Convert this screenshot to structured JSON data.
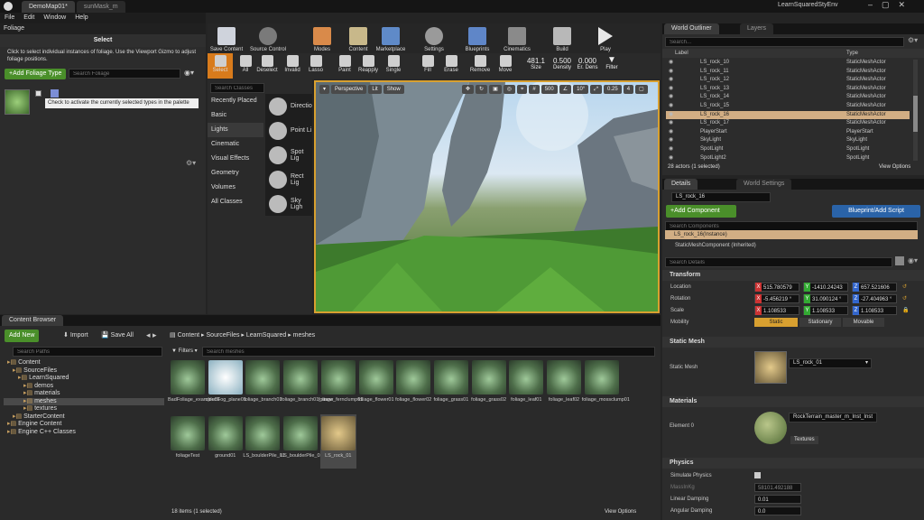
{
  "window": {
    "tabs": [
      "DemoMap01*",
      "sunMask_m"
    ],
    "project": "LearnSquaredStyEnv"
  },
  "menu": [
    "File",
    "Edit",
    "Window",
    "Help"
  ],
  "foliage": {
    "tab": "Foliage",
    "mode_title": "Select",
    "hint": "Click to select individual instances of foliage.  Use the Viewport Gizmo to adjust foliage positions.",
    "add_type": "+Add Foliage Type",
    "search_placeholder": "Search Foliage",
    "tooltip": "Check to activate the currently selected types in the palette"
  },
  "toolbar": [
    "Save Content",
    "Source Control",
    "Modes",
    "Content",
    "Marketplace",
    "Settings",
    "Blueprints",
    "Cinematics",
    "Build",
    "Play"
  ],
  "foliage_tools": [
    {
      "label": "Select",
      "icon": "select-icon"
    },
    {
      "label": "All",
      "icon": "all-icon"
    },
    {
      "label": "Deselect",
      "icon": "deselect-icon"
    },
    {
      "label": "Invalid",
      "icon": "invalid-icon"
    },
    {
      "label": "Lasso",
      "icon": "lasso-icon"
    },
    {
      "label": "Paint",
      "icon": "paint-icon"
    },
    {
      "label": "Reapply",
      "icon": "reapply-icon"
    },
    {
      "label": "Single",
      "icon": "single-icon"
    },
    {
      "label": "Fill",
      "icon": "fill-icon"
    },
    {
      "label": "Erase",
      "icon": "erase-icon"
    },
    {
      "label": "Remove",
      "icon": "remove-icon"
    },
    {
      "label": "Move",
      "icon": "move-icon"
    }
  ],
  "brush": {
    "size": "481.1",
    "size_label": "Size",
    "density": "0.500",
    "density_label": "Density",
    "erase_density": "0.000",
    "erase_label": "Er. Dens",
    "filter": "Filter"
  },
  "place": {
    "search": "Search Classes",
    "categories": [
      "Recently Placed",
      "Basic",
      "Lights",
      "Cinematic",
      "Visual Effects",
      "Geometry",
      "Volumes",
      "All Classes"
    ],
    "selected": "Lights",
    "items": [
      "Directio",
      "Point Li",
      "Spot Lig",
      "Rect Lig",
      "Sky Ligh"
    ]
  },
  "viewport": {
    "perspective": "Perspective",
    "lit": "Lit",
    "show": "Show",
    "grid": "500",
    "angle": "10°",
    "scale": "0.25",
    "cam": "4"
  },
  "outliner": {
    "tab": "World Outliner",
    "tab2": "Layers",
    "search": "Search...",
    "col_label": "Label",
    "col_type": "Type",
    "rows": [
      [
        "LS_rock_10",
        "StaticMeshActor"
      ],
      [
        "LS_rock_11",
        "StaticMeshActor"
      ],
      [
        "LS_rock_12",
        "StaticMeshActor"
      ],
      [
        "LS_rock_13",
        "StaticMeshActor"
      ],
      [
        "LS_rock_14",
        "StaticMeshActor"
      ],
      [
        "LS_rock_15",
        "StaticMeshActor"
      ],
      [
        "LS_rock_16",
        "StaticMeshActor"
      ],
      [
        "LS_rock_17",
        "StaticMeshActor"
      ],
      [
        "PlayerStart",
        "PlayerStart"
      ],
      [
        "SkyLight",
        "SkyLight"
      ],
      [
        "SpotLight",
        "SpotLight"
      ],
      [
        "SpotLight2",
        "SpotLight"
      ]
    ],
    "selected_index": 6,
    "count": "28 actors (1 selected)",
    "view": "View Options"
  },
  "details": {
    "tab": "Details",
    "tab2": "World Settings",
    "name": "LS_rock_16",
    "add_component": "+Add Component",
    "blueprint": "Blueprint/Add Script",
    "search_components": "Search Components",
    "instance": "LS_rock_16(Instance)",
    "component": "StaticMeshComponent (Inherited)",
    "search_details": "Search Details",
    "transform": "Transform",
    "location_label": "Location",
    "location": [
      "515.780579",
      "-1410.24243",
      "657.521606"
    ],
    "rotation_label": "Rotation",
    "rotation": [
      "-5.456219 °",
      "31.090124 °",
      "-27.404963 °"
    ],
    "scale_label": "Scale",
    "scale": [
      "1.108533",
      "1.108533",
      "1.108533"
    ],
    "mobility_label": "Mobility",
    "mobility": [
      "Static",
      "Stationary",
      "Movable"
    ],
    "static_mesh_section": "Static Mesh",
    "static_mesh_label": "Static Mesh",
    "static_mesh": "LS_rock_01",
    "materials_section": "Materials",
    "element_label": "Element 0",
    "material": "RockTerrain_master_m_Inst_Inst",
    "textures": "Textures",
    "physics_section": "Physics",
    "simulate": "Simulate Physics",
    "mass_label": "MassInKg",
    "mass": "58101.492188",
    "lin_damp_label": "Linear Damping",
    "lin_damp": "0.01",
    "ang_damp_label": "Angular Damping",
    "ang_damp": "0.0"
  },
  "content": {
    "tab": "Content Browser",
    "add_new": "Add New",
    "import": "Import",
    "save_all": "Save All",
    "path": [
      "Content",
      "SourceFiles",
      "LearnSquared",
      "meshes"
    ],
    "search_paths": "Search Paths",
    "filters": "Filters",
    "search": "Search meshes",
    "tree": [
      {
        "label": "Content",
        "level": 0
      },
      {
        "label": "SourceFiles",
        "level": 1
      },
      {
        "label": "LearnSquared",
        "level": 2
      },
      {
        "label": "demos",
        "level": 3
      },
      {
        "label": "materials",
        "level": 3
      },
      {
        "label": "meshes",
        "level": 3
      },
      {
        "label": "textures",
        "level": 3
      },
      {
        "label": "StarterContent",
        "level": 1
      },
      {
        "label": "Engine Content",
        "level": 0
      },
      {
        "label": "Engine C++ Classes",
        "level": 0
      }
    ],
    "assets": [
      "BadFoliage_example01",
      "cloudFog_plane01",
      "foliage_branch01",
      "foliage_branch01_snow",
      "foliage_fernclump01",
      "foliage_flower01",
      "foliage_flower02",
      "foliage_grass01",
      "foliage_grass02",
      "foliage_leaf01",
      "foliage_leaf02",
      "foliage_mossclump01",
      "foliageTest",
      "ground01",
      "LS_boulderPile_01",
      "LS_boulderPile_02",
      "LS_rock_01"
    ],
    "count": "18 items (1 selected)",
    "view": "View Options"
  }
}
